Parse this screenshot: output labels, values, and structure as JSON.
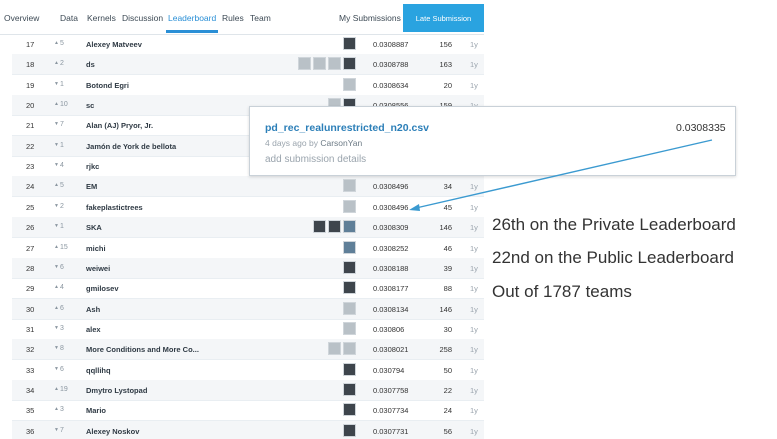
{
  "nav": {
    "tabs": [
      "Overview",
      "Data",
      "Kernels",
      "Discussion",
      "Leaderboard",
      "Rules",
      "Team"
    ],
    "active_tab": "Leaderboard",
    "my_submissions": "My Submissions",
    "late_submission": "Late Submission"
  },
  "rows": [
    {
      "rank": "17",
      "dir": "up",
      "delta": "5",
      "team": "Alexey Matveev",
      "avatars": [
        "dark"
      ],
      "score": "0.0308887",
      "entries": "156",
      "last": "1y"
    },
    {
      "rank": "18",
      "dir": "up",
      "delta": "2",
      "team": "ds",
      "avatars": [
        "dark",
        "light",
        "light",
        "light"
      ],
      "score": "0.0308788",
      "entries": "163",
      "last": "1y"
    },
    {
      "rank": "19",
      "dir": "down",
      "delta": "1",
      "team": "Botond Egri",
      "avatars": [
        "light"
      ],
      "score": "0.0308634",
      "entries": "20",
      "last": "1y"
    },
    {
      "rank": "20",
      "dir": "up",
      "delta": "10",
      "team": "sc",
      "avatars": [
        "dark",
        "light"
      ],
      "score": "0.0308556",
      "entries": "159",
      "last": "1y"
    },
    {
      "rank": "21",
      "dir": "down",
      "delta": "7",
      "team": "Alan (AJ) Pryor, Jr.",
      "avatars": [],
      "score": "",
      "entries": "",
      "last": ""
    },
    {
      "rank": "22",
      "dir": "down",
      "delta": "1",
      "team": "Jamón de York de bellota",
      "avatars": [],
      "score": "",
      "entries": "",
      "last": ""
    },
    {
      "rank": "23",
      "dir": "down",
      "delta": "4",
      "team": "rjkc",
      "avatars": [],
      "score": "",
      "entries": "",
      "last": ""
    },
    {
      "rank": "24",
      "dir": "up",
      "delta": "5",
      "team": "EM",
      "avatars": [
        "light"
      ],
      "score": "0.0308496",
      "entries": "34",
      "last": "1y"
    },
    {
      "rank": "25",
      "dir": "down",
      "delta": "2",
      "team": "fakeplastictrees",
      "avatars": [
        "light"
      ],
      "score": "0.0308496",
      "entries": "45",
      "last": "1y"
    },
    {
      "rank": "26",
      "dir": "down",
      "delta": "1",
      "team": "SKA",
      "avatars": [
        "sky",
        "dark",
        "dark"
      ],
      "score": "0.0308309",
      "entries": "146",
      "last": "1y"
    },
    {
      "rank": "27",
      "dir": "up",
      "delta": "15",
      "team": "michi",
      "avatars": [
        "sky"
      ],
      "score": "0.0308252",
      "entries": "46",
      "last": "1y"
    },
    {
      "rank": "28",
      "dir": "down",
      "delta": "6",
      "team": "weiwei",
      "avatars": [
        "dark"
      ],
      "score": "0.0308188",
      "entries": "39",
      "last": "1y"
    },
    {
      "rank": "29",
      "dir": "up",
      "delta": "4",
      "team": "gmilosev",
      "avatars": [
        "dark"
      ],
      "score": "0.0308177",
      "entries": "88",
      "last": "1y"
    },
    {
      "rank": "30",
      "dir": "up",
      "delta": "6",
      "team": "Ash",
      "avatars": [
        "light"
      ],
      "score": "0.0308134",
      "entries": "146",
      "last": "1y"
    },
    {
      "rank": "31",
      "dir": "down",
      "delta": "3",
      "team": "alex",
      "avatars": [
        "light"
      ],
      "score": "0.030806",
      "entries": "30",
      "last": "1y"
    },
    {
      "rank": "32",
      "dir": "down",
      "delta": "8",
      "team": "More Conditions and More Co...",
      "avatars": [
        "light",
        "light"
      ],
      "score": "0.0308021",
      "entries": "258",
      "last": "1y"
    },
    {
      "rank": "33",
      "dir": "down",
      "delta": "6",
      "team": "qqllihq",
      "avatars": [
        "dark"
      ],
      "score": "0.030794",
      "entries": "50",
      "last": "1y"
    },
    {
      "rank": "34",
      "dir": "up",
      "delta": "19",
      "team": "Dmytro Lystopad",
      "avatars": [
        "dark"
      ],
      "score": "0.0307758",
      "entries": "22",
      "last": "1y"
    },
    {
      "rank": "35",
      "dir": "up",
      "delta": "3",
      "team": "Mario",
      "avatars": [
        "dark"
      ],
      "score": "0.0307734",
      "entries": "24",
      "last": "1y"
    },
    {
      "rank": "36",
      "dir": "down",
      "delta": "7",
      "team": "Alexey Noskov",
      "avatars": [
        "dark"
      ],
      "score": "0.0307731",
      "entries": "56",
      "last": "1y"
    }
  ],
  "popup": {
    "filename": "pd_rec_realunrestricted_n20.csv",
    "time": "4 days ago",
    "by": "by",
    "user": "CarsonYan",
    "add_details": "add submission details",
    "score": "0.0308335"
  },
  "annotation": {
    "line1": "26th on the Private Leaderboard",
    "line2": "22nd on the Public Leaderboard",
    "line3": "Out of 1787 teams"
  },
  "colors": {
    "accent": "#2a8fd6",
    "late_button": "#2aa3e0",
    "arrow": "#3b9ad0"
  }
}
